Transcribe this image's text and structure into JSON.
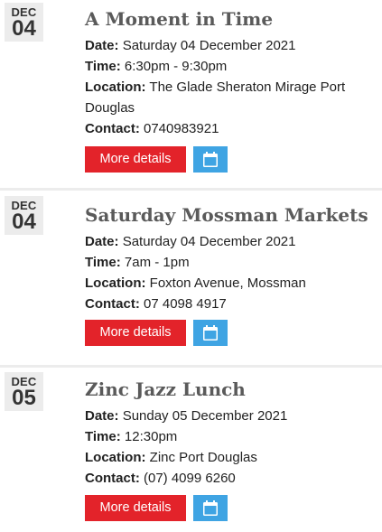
{
  "labels": {
    "date": "Date:",
    "time": "Time:",
    "location": "Location:",
    "contact": "Contact:",
    "more_details": "More details"
  },
  "icons": {
    "calendar": "calendar-icon"
  },
  "colors": {
    "more_details_bg": "#e3232a",
    "calendar_bg": "#3fa4e3",
    "date_box_bg": "#ececec",
    "title": "#5a5a5a"
  },
  "events": [
    {
      "month": "DEC",
      "day": "04",
      "title": "A Moment in Time",
      "date": "Saturday 04 December 2021",
      "time": "6:30pm - 9:30pm",
      "location": "The Glade Sheraton Mirage Port Douglas",
      "contact": "0740983921"
    },
    {
      "month": "DEC",
      "day": "04",
      "title": "Saturday Mossman Markets",
      "date": "Saturday 04 December 2021",
      "time": "7am - 1pm",
      "location": "Foxton Avenue, Mossman",
      "contact": "07 4098 4917"
    },
    {
      "month": "DEC",
      "day": "05",
      "title": "Zinc Jazz Lunch",
      "date": "Sunday 05 December 2021",
      "time": "12:30pm",
      "location": "Zinc Port Douglas",
      "contact": "(07) 4099 6260"
    }
  ]
}
